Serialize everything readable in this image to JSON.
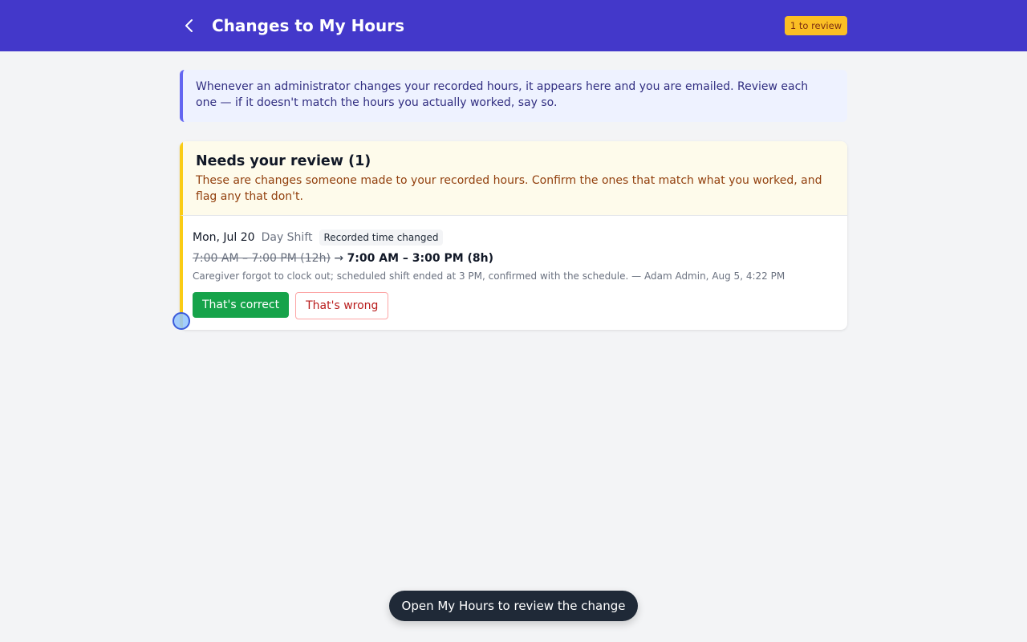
{
  "header": {
    "title": "Changes to My Hours",
    "badge": "1 to review",
    "back_icon": "chevron-left-icon"
  },
  "info": {
    "text": "Whenever an administrator changes your recorded hours, it appears here and you are emailed. Review each one — if it doesn't match the hours you actually worked, say so."
  },
  "review": {
    "title": "Needs your review (1)",
    "description": "These are changes someone made to your recorded hours. Confirm the ones that match what you worked, and flag any that don't.",
    "items": [
      {
        "date": "Mon, Jul 20",
        "shift": "Day Shift",
        "tag": "Recorded time changed",
        "old_time": "7:00 AM – 7:00 PM (12h)",
        "arrow": "→",
        "new_time": "7:00 AM – 3:00 PM (8h)",
        "note": "Caregiver forgot to clock out; scheduled shift ended at 3 PM, confirmed with the schedule. — Adam Admin, Aug 5, 4:22 PM",
        "confirm_label": "That's correct",
        "flag_label": "That's wrong"
      }
    ]
  },
  "toast": {
    "text": "Open My Hours to review the change"
  },
  "colors": {
    "header_bg": "#4338ca",
    "badge_bg": "#fbbf24",
    "confirm_green": "#16a34a",
    "flag_red": "#b91c1c",
    "review_accent": "#facc15",
    "info_accent": "#6366f1"
  }
}
